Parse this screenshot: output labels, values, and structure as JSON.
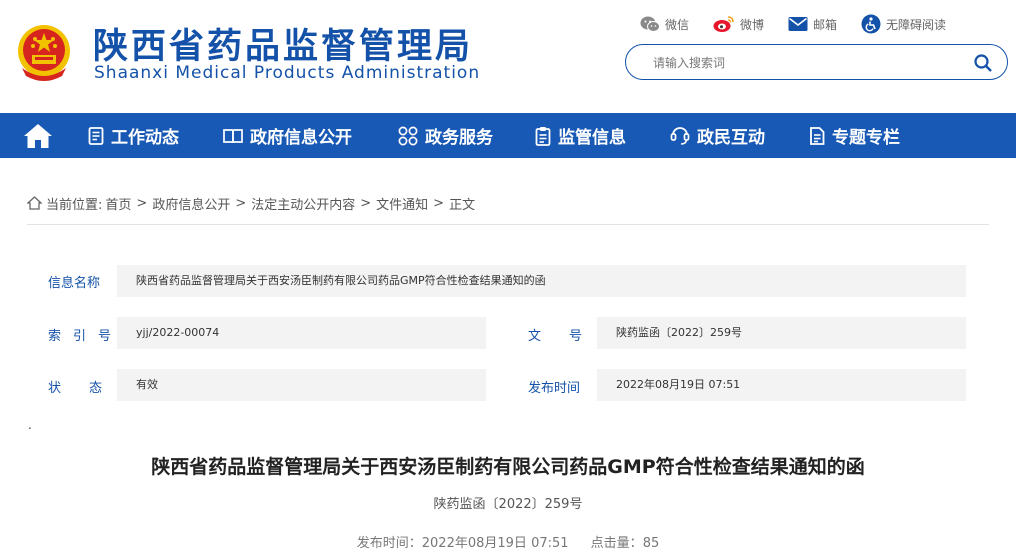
{
  "header": {
    "cn_title": "陕西省药品监督管理局",
    "en_title": "Shaanxi Medical Products Administration",
    "links": [
      {
        "label": "微信",
        "icon": "wechat-icon"
      },
      {
        "label": "微博",
        "icon": "weibo-icon"
      },
      {
        "label": "邮箱",
        "icon": "mail-icon"
      },
      {
        "label": "无障碍阅读",
        "icon": "accessibility-icon"
      }
    ],
    "search_placeholder": "请输入搜索词"
  },
  "nav": {
    "items": [
      {
        "label": "工作动态",
        "icon": "document-icon"
      },
      {
        "label": "政府信息公开",
        "icon": "book-icon"
      },
      {
        "label": "政务服务",
        "icon": "grid-icon"
      },
      {
        "label": "监管信息",
        "icon": "clipboard-icon"
      },
      {
        "label": "政民互动",
        "icon": "chat-icon"
      },
      {
        "label": "专题专栏",
        "icon": "file-icon"
      }
    ]
  },
  "breadcrumb": {
    "prefix": "当前位置:",
    "items": [
      "首页",
      "政府信息公开",
      "法定主动公开内容",
      "文件通知"
    ],
    "current": "正文"
  },
  "info": {
    "name_label": "信息名称",
    "name_value": "陕西省药品监督管理局关于西安汤臣制药有限公司药品GMP符合性检查结果通知的函",
    "index_label": "索引号",
    "index_value": "yjj/2022-00074",
    "docno_label": "文号",
    "docno_value": "陕药监函〔2022〕259号",
    "status_label": "状态",
    "status_value": "有效",
    "date_label": "发布时间",
    "date_value": "2022年08月19日 07:51"
  },
  "article": {
    "dot": ".",
    "title": "陕西省药品监督管理局关于西安汤臣制药有限公司药品GMP符合性检查结果通知的函",
    "doc_no": "陕药监函〔2022〕259号",
    "publish_label": "发布时间：",
    "publish_value": "2022年08月19日 07:51",
    "views_label": "点击量：",
    "views_value": "85"
  },
  "colors": {
    "brand_blue": "#1452a9",
    "nav_blue": "#1859b5",
    "field_bg": "#f3f3f3",
    "emblem_red": "#d6241e",
    "emblem_gold": "#f2c200"
  }
}
